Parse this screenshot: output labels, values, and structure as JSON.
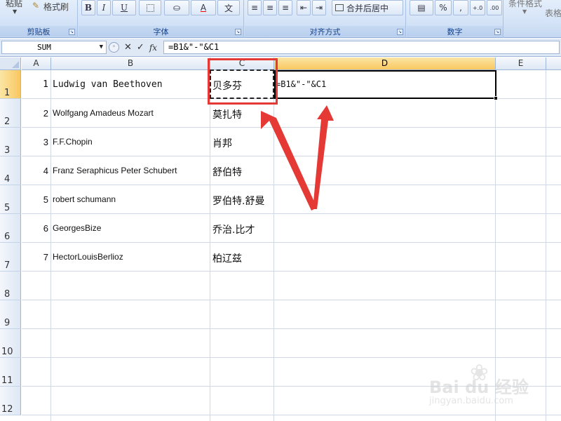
{
  "ribbon": {
    "paste_label": "粘贴",
    "format_painter_label": "格式刷",
    "merge_center_label": "合并后居中",
    "percent_symbol": "%",
    "comma_symbol": ",",
    "conditional_format_label": "条件格式",
    "table_label": "表格",
    "font_color_letter": "A",
    "bold_letter": "B",
    "italic_letter": "I",
    "underline_letter": "U",
    "phonetic_letter": "文",
    "groups": {
      "clipboard": "剪贴板",
      "font": "字体",
      "alignment": "对齐方式",
      "number": "数字"
    }
  },
  "formula_bar": {
    "name_box": "SUM",
    "fx_label": "fx",
    "formula": "=B1&\"-\"&C1"
  },
  "columns": [
    "A",
    "B",
    "C",
    "D",
    "E"
  ],
  "rows": [
    "1",
    "2",
    "3",
    "4",
    "5",
    "6",
    "7",
    "8",
    "9",
    "10",
    "11",
    "12"
  ],
  "data": [
    {
      "a": "1",
      "b": "Ludwig van Beethoven",
      "c": "贝多芬",
      "d": "=B1&\"-\"&C1"
    },
    {
      "a": "2",
      "b": "Wolfgang Amadeus Mozart",
      "c": "莫扎特",
      "d": ""
    },
    {
      "a": "3",
      "b": "F.F.Chopin",
      "c": "肖邦",
      "d": ""
    },
    {
      "a": "4",
      "b": "Franz Seraphicus Peter Schubert",
      "c": "舒伯特",
      "d": ""
    },
    {
      "a": "5",
      "b": "robert schumann",
      "c": "罗伯特.舒曼",
      "d": ""
    },
    {
      "a": "6",
      "b": "GeorgesBize",
      "c": "乔治.比才",
      "d": ""
    },
    {
      "a": "7",
      "b": "HectorLouisBerlioz",
      "c": "柏辽兹",
      "d": ""
    }
  ],
  "colors": {
    "annotation_red": "#e53935",
    "selected_header": "#f9c760"
  },
  "watermark": {
    "brand": "Bai du 经验",
    "url": "jingyan.baidu.com"
  }
}
